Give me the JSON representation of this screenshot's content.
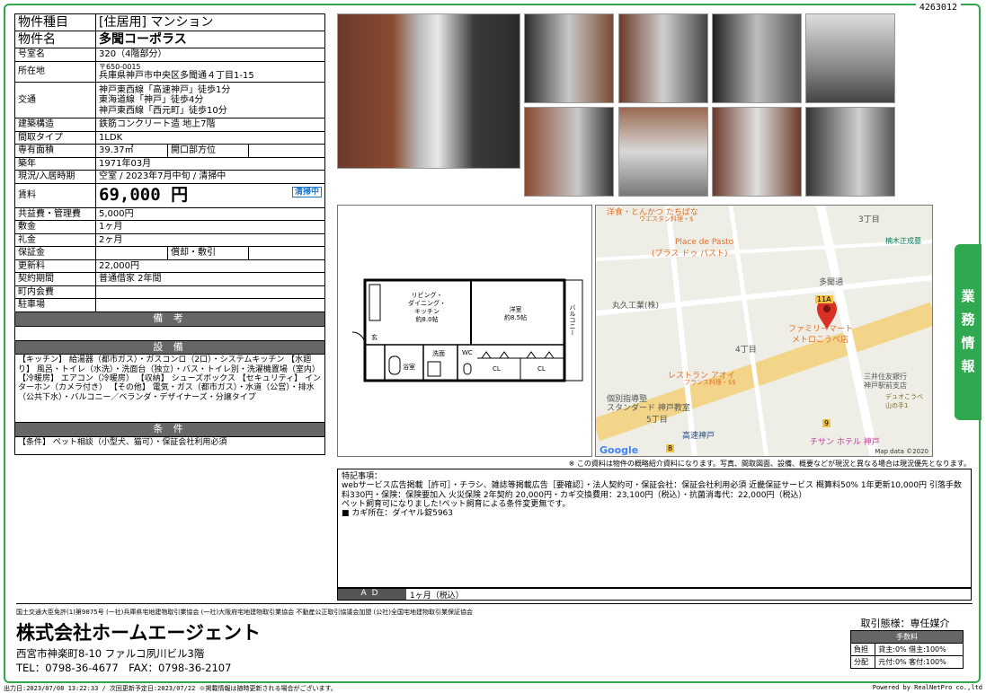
{
  "doc_id": "4263012",
  "spec": {
    "type_label": "物件種目",
    "type_value": "[住居用] マンション",
    "name_label": "物件名",
    "name_value": "多聞コーポラス",
    "room_label": "号室名",
    "room_value": "320（4階部分）",
    "loc_label": "所在地",
    "postal": "〒650-0015",
    "address": "兵庫県神戸市中央区多聞通４丁目1-15",
    "transport_label": "交通",
    "transport": [
      "神戸東西線「高速神戸」徒歩1分",
      "東海道線「神戸」徒歩4分",
      "神戸東西線「西元町」徒歩10分"
    ],
    "structure_label": "建築構造",
    "structure_value": "鉄筋コンクリート造 地上7階",
    "layout_label": "間取タイプ",
    "layout_value": "1LDK",
    "area_label": "専有面積",
    "area_value": "39.37㎡",
    "facing_label": "開口部方位",
    "facing_value": "",
    "built_label": "築年",
    "built_value": "1971年03月",
    "status_label": "現況/入居時期",
    "status_value": "空室 / 2023年7月中旬 / 清掃中",
    "rent_label": "賃料",
    "rent_value": "69,000 円",
    "clean_badge": "清掃中",
    "mgmt_label": "共益費・管理費",
    "mgmt_value": "5,000円",
    "deposit_label": "敷金",
    "deposit_value": "1ヶ月",
    "keymoney_label": "礼金",
    "keymoney_value": "2ヶ月",
    "guarantee_label": "保証金",
    "guarantee_value": "",
    "amort_label": "償却・敷引",
    "amort_value": "",
    "renew_label": "更新料",
    "renew_value": "22,000円",
    "contract_label": "契約期間",
    "contract_value": "普通借家 2年間",
    "assoc_label": "町内会費",
    "assoc_value": "",
    "parking_label": "駐車場",
    "parking_value": ""
  },
  "remarks_head": "備 考",
  "remarks_text": "",
  "equip_head": "設 備",
  "equip_text": "【キッチン】 給湯器（都市ガス）・ガスコンロ（2口）・システムキッチン 【水廻り】 風呂・トイレ（水洗）・洗面台（独立）・バス・トイレ別・洗濯機置場（室内） 【冷暖房】 エアコン（冷暖房） 【収納】 シューズボックス 【セキュリティ】 インターホン（カメラ付き） 【その他】 電気・ガス（都市ガス）・水道（公営）・排水（公共下水）・バルコニー／ベランダ・デザイナーズ・分譲タイプ",
  "cond_head": "条 件",
  "cond_text": "【条件】 ペット相談（小型犬、猫可）・保証会社利用必須",
  "plan": {
    "ldk": "リビング・\nダイニング・\nキッチン\n約8.0帖",
    "western": "洋室\n約8.5帖",
    "balcony": "バルコニー",
    "entrance": "玄",
    "wash": "洗面",
    "wc": "WC",
    "bath": "浴室",
    "cl1": "CL",
    "cl2": "CL"
  },
  "map": {
    "labels": [
      "洋食・とんかつ たちばな",
      "ウエスタン料理・$",
      "Place de Pasto",
      "(プラス ドゥ パスト)",
      "丸久工業(株)",
      "多聞通",
      "ファミリーマート",
      "メトロこうべ店",
      "4丁目",
      "3丁目",
      "5丁目",
      "楠木正成墓",
      "レストラン アオイ",
      "フランス料理・$$",
      "個別指導塾",
      "スタンダード 神戸教室",
      "高速神戸",
      "三井住友銀行",
      "神戸駅前支店",
      "チサン ホテル 神戸",
      "デュオこうべ",
      "山の手1",
      "11A",
      "9",
      "8",
      "Google",
      "Map data ©2020"
    ]
  },
  "note": "※ この資料は物件の概略紹介資料になります。写真、間取図面、設備、概要などが現況と異なる場合は現況優先となります。",
  "special": {
    "head": "特記事項：",
    "lines": [
      "webサービス広告掲載［許可］・チラシ、雑誌等掲載広告［要確認］・法人契約可・保証会社：保証会社利用必須 近畿保証サービス 概算料50% 1年更新10,000円 引落手数料330円・保険：保険要加入 火災保険 2年契約 20,000円・カギ交換費用：23,100円（税込）・抗菌消毒代：22,000円（税込）",
      "ペット飼育可になりました!ペット飼育による条件変更無です。",
      "■ カギ所在：ダイヤル錠5963"
    ]
  },
  "ad": {
    "label": "AD",
    "value": "1ヶ月（税込）"
  },
  "sidebar": {
    "text": "業務情報"
  },
  "footer": {
    "license": "国土交通大臣免許(1)第9875号 (一社)兵庫県宅地建物取引業協会 (一社)大阪府宅地建物取引業協会 不動産公正取引協議会加盟 (公社)全国宅地建物取引業保証協会",
    "company": "株式会社ホームエージェント",
    "address": "西宮市神楽町8-10 ファルコ夙川ビル3階",
    "tel": "TEL：0798-36-4677　FAX：0798-36-2107"
  },
  "deal": {
    "title": "取引態様：専任媒介",
    "fee_head": "手数料",
    "burden_label": "負担",
    "burden_value": "貸主:0% 借主:100%",
    "split_label": "分配",
    "split_value": "元付:0% 客付:100%"
  },
  "bottom": {
    "left": "出力日:2023/07/08 13:22:33 / 次回更新予定日:2023/07/22 ※掲載情報は随時更新される場合がございます。",
    "right": "Powered by RealNetPro co.,ltd"
  },
  "colors": {
    "accent_green": "#2fa84f",
    "header_gray": "#666666",
    "badge_blue": "#1b74c9"
  }
}
